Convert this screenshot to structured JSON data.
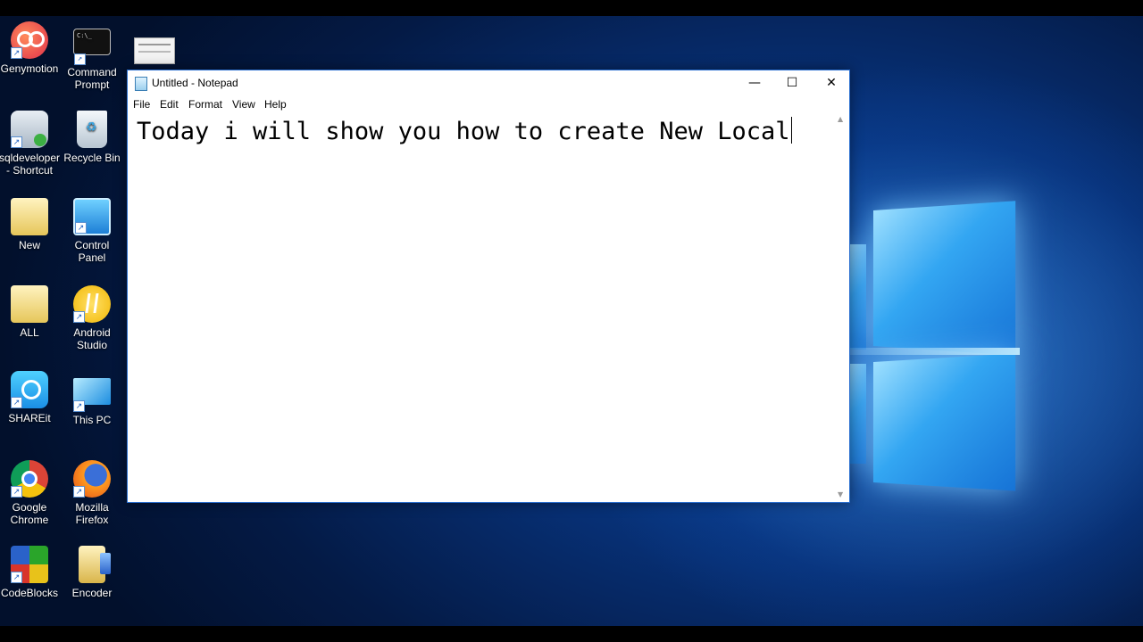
{
  "desktop": {
    "icons": [
      {
        "label": "Genymotion",
        "icon": "genymotion-icon"
      },
      {
        "label": "Command Prompt",
        "icon": "command-prompt-icon"
      },
      {
        "label": "sqldeveloper - Shortcut",
        "icon": "sqldeveloper-icon"
      },
      {
        "label": "Recycle Bin",
        "icon": "recycle-bin-icon"
      },
      {
        "label": "New",
        "icon": "folder-icon"
      },
      {
        "label": "Control Panel",
        "icon": "control-panel-icon"
      },
      {
        "label": "ALL",
        "icon": "folder-icon"
      },
      {
        "label": "Android Studio",
        "icon": "android-studio-icon"
      },
      {
        "label": "SHAREit",
        "icon": "shareit-icon"
      },
      {
        "label": "This PC",
        "icon": "this-pc-icon"
      },
      {
        "label": "Google Chrome",
        "icon": "chrome-icon"
      },
      {
        "label": "Mozilla Firefox",
        "icon": "firefox-icon"
      },
      {
        "label": "CodeBlocks",
        "icon": "codeblocks-icon"
      },
      {
        "label": "Encoder",
        "icon": "encoder-icon"
      }
    ]
  },
  "window": {
    "title": "Untitled - Notepad",
    "minimize": "—",
    "maximize": "☐",
    "close": "✕",
    "menu": [
      "File",
      "Edit",
      "Format",
      "View",
      "Help"
    ],
    "text": "Today i will show you how to create New Local"
  },
  "colors": {
    "accent": "#2a6fd0",
    "desktop_blue": "#0b4aa5"
  }
}
